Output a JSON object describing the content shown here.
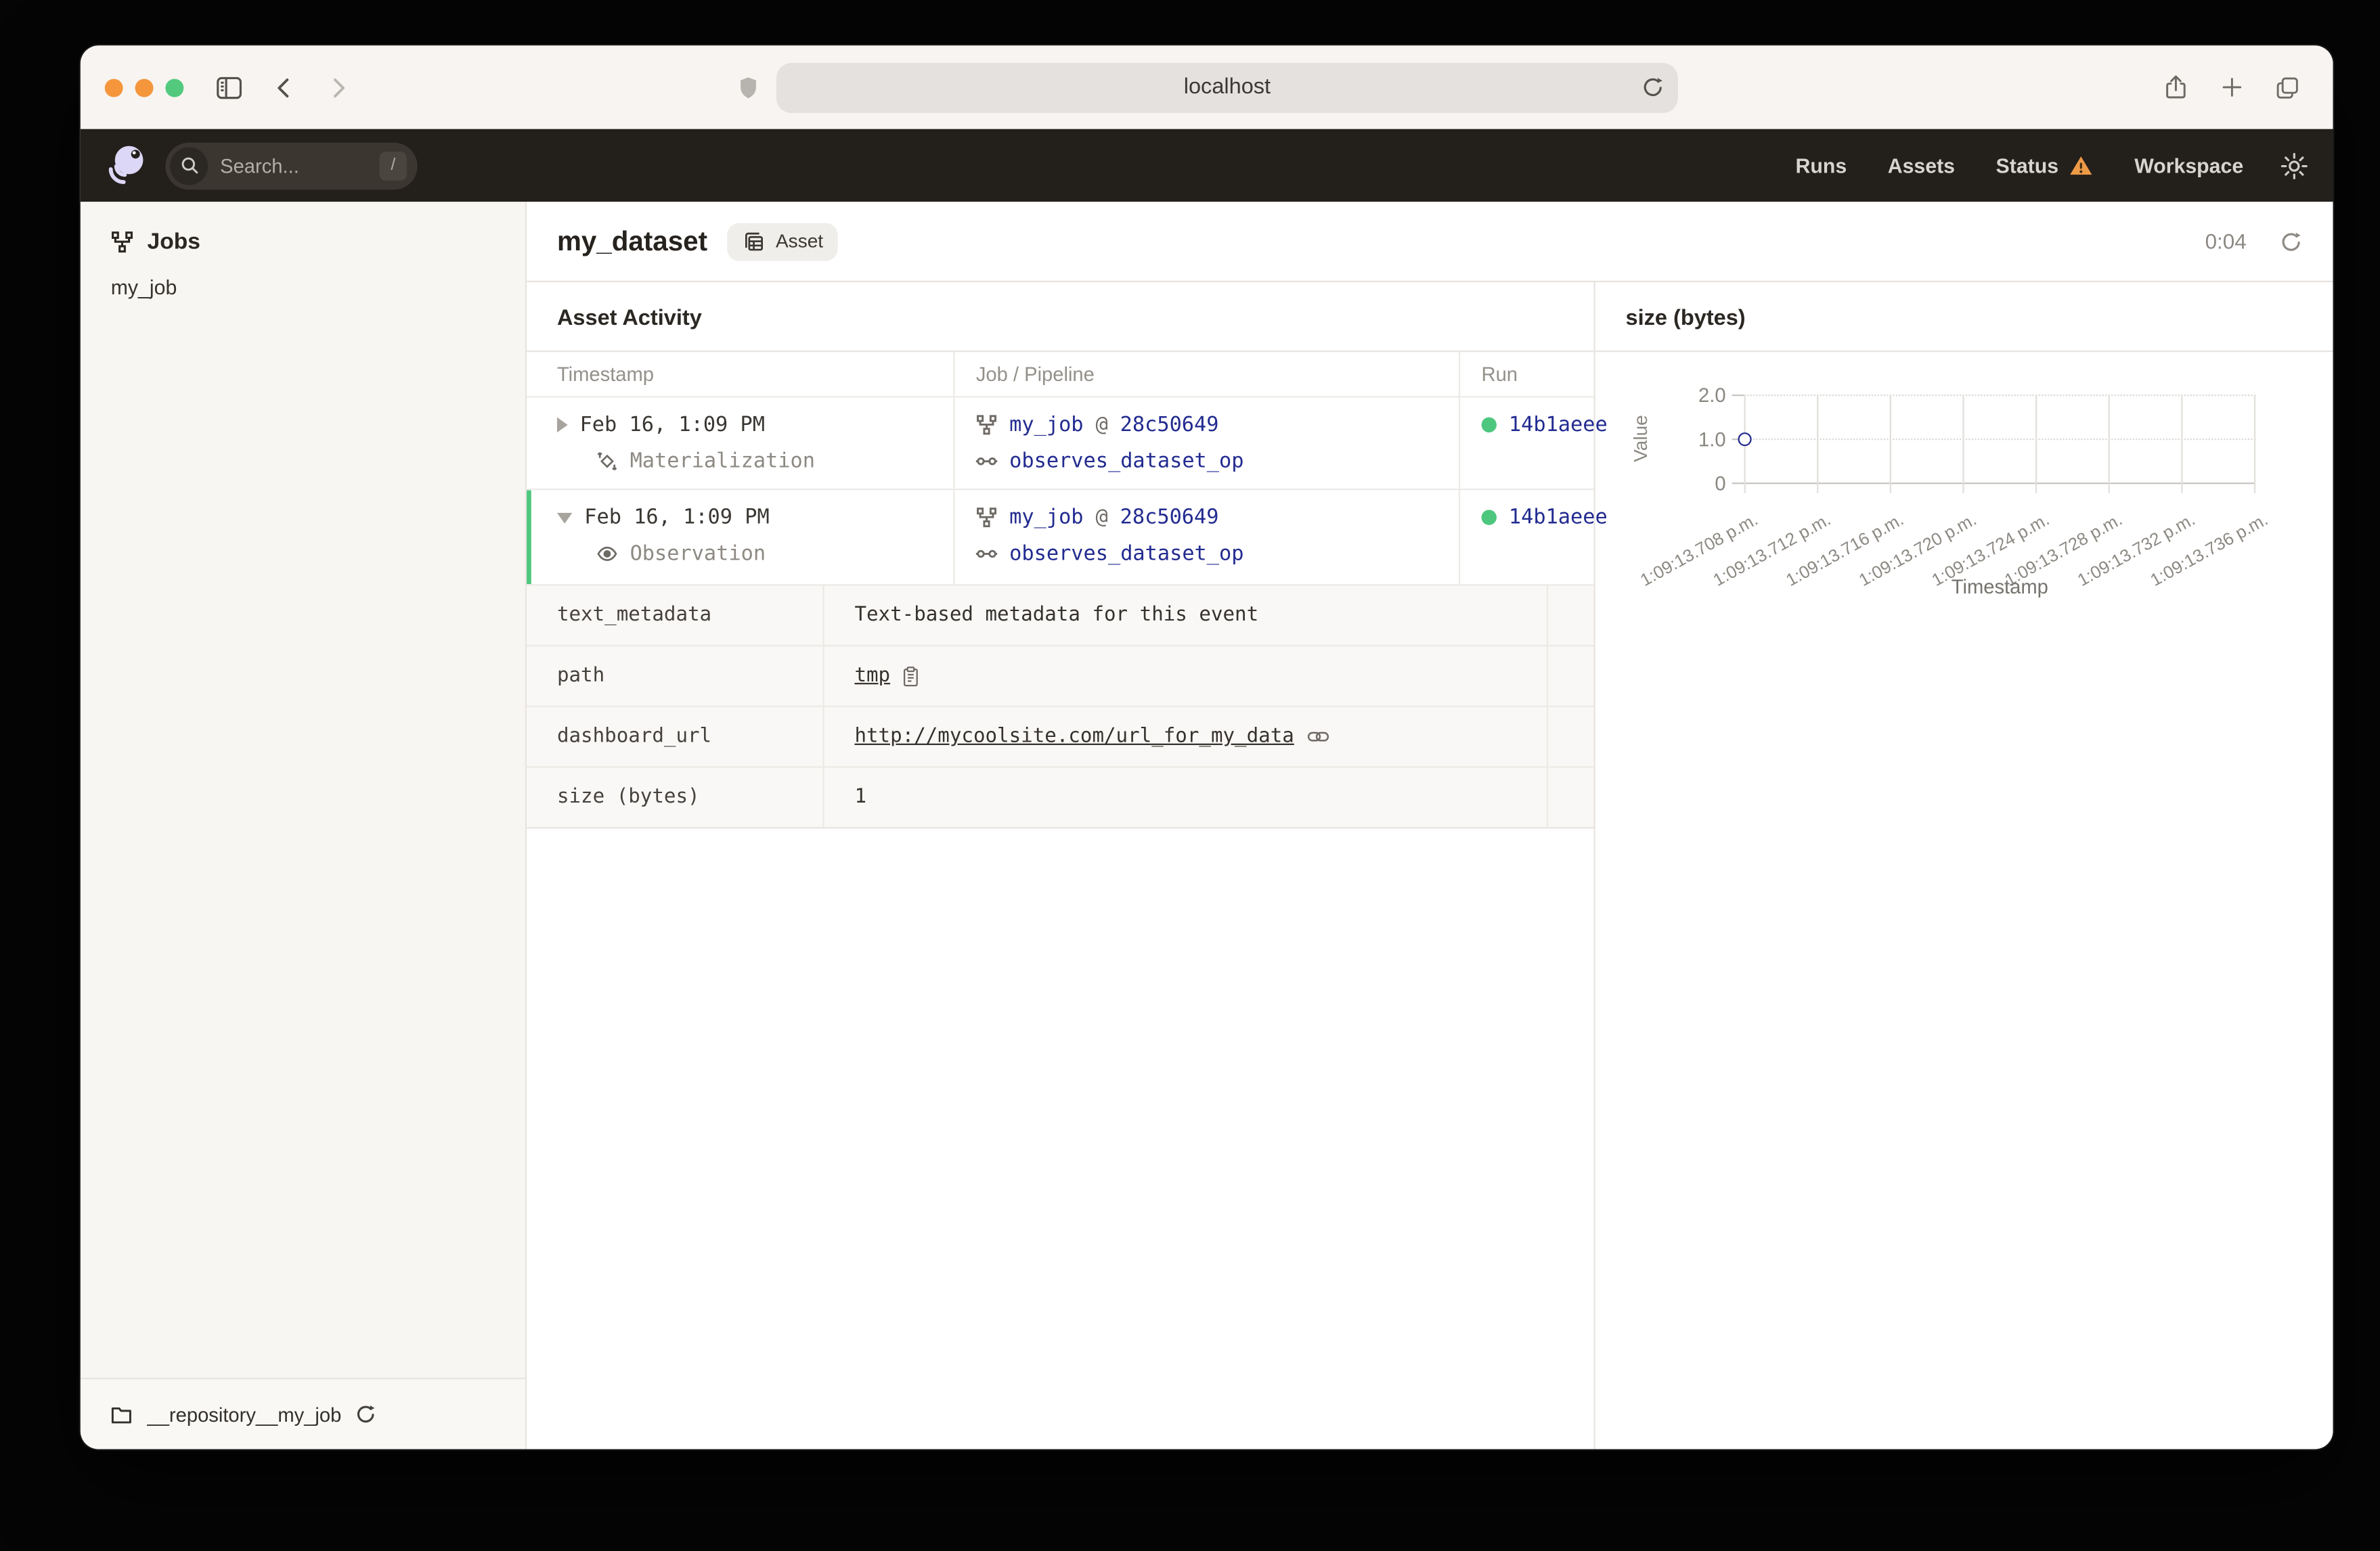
{
  "browser": {
    "url": "localhost",
    "traffic_lights": [
      "#f5963c",
      "#f5963c",
      "#53c97e"
    ]
  },
  "nav": {
    "search_placeholder": "Search...",
    "search_shortcut": "/",
    "links": [
      "Runs",
      "Assets",
      "Status",
      "Workspace"
    ]
  },
  "sidebar": {
    "title": "Jobs",
    "jobs": [
      "my_job"
    ],
    "repository": "__repository__my_job"
  },
  "page": {
    "title": "my_dataset",
    "tag": "Asset",
    "timer": "0:04"
  },
  "activity": {
    "title": "Asset Activity",
    "columns": [
      "Timestamp",
      "Job / Pipeline",
      "Run"
    ],
    "rows": [
      {
        "timestamp": "Feb 16, 1:09 PM",
        "type": "Materialization",
        "job": "my_job",
        "sep": "@",
        "version": "28c50649",
        "op": "observes_dataset_op",
        "run_id": "14b1aeee",
        "expanded": false
      },
      {
        "timestamp": "Feb 16, 1:09 PM",
        "type": "Observation",
        "job": "my_job",
        "sep": "@",
        "version": "28c50649",
        "op": "observes_dataset_op",
        "run_id": "14b1aeee",
        "expanded": true
      }
    ],
    "metadata": [
      {
        "key": "text_metadata",
        "value": "Text-based metadata for this event"
      },
      {
        "key": "path",
        "value": "tmp"
      },
      {
        "key": "dashboard_url",
        "value": "http://mycoolsite.com/url_for_my_data"
      },
      {
        "key": "size (bytes)",
        "value": "1"
      }
    ]
  },
  "chart_data": {
    "type": "scatter",
    "title": "size (bytes)",
    "xlabel": "Timestamp",
    "ylabel": "Value",
    "ylim": [
      0,
      2
    ],
    "y_tick_labels": [
      "2.0",
      "1.0",
      "0"
    ],
    "x_tick_labels": [
      "1:09:13.708 p.m.",
      "1:09:13.712 p.m.",
      "1:09:13.716 p.m.",
      "1:09:13.720 p.m.",
      "1:09:13.724 p.m.",
      "1:09:13.728 p.m.",
      "1:09:13.732 p.m.",
      "1:09:13.736 p.m."
    ],
    "points": [
      {
        "x": "1:09:13.708 p.m.",
        "y": 1
      }
    ],
    "grid": true,
    "legend": false
  },
  "colors": {
    "accent_green": "#4ec77e",
    "link_blue": "#222b90",
    "warning_orange": "#ed9a47",
    "nav_bg": "#231f1b"
  }
}
